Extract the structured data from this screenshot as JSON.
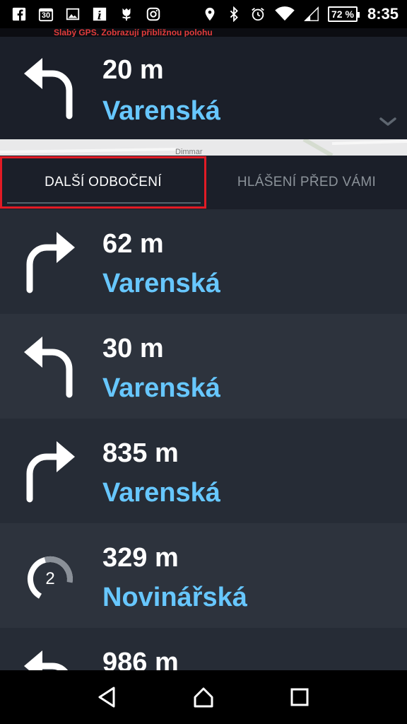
{
  "status_bar": {
    "left_icons": [
      "facebook-icon",
      "calendar-30-icon",
      "image-icon",
      "info-icon",
      "tulip-icon",
      "instagram-icon"
    ],
    "calendar_day": "30",
    "right_icons": [
      "location-icon",
      "bluetooth-icon",
      "alarm-icon",
      "wifi-icon",
      "signal-icon"
    ],
    "battery": "72 %",
    "time": "8:35"
  },
  "banner": {
    "text": "Slabý GPS. Zobrazují přibližnou polohu"
  },
  "current_instruction": {
    "direction": "left",
    "distance": "20 m",
    "street": "Varenská"
  },
  "map_peek": {
    "label": "Dimmar"
  },
  "tabs": {
    "turns": "DALŠÍ ODBOČENÍ",
    "reports": "HLÁŠENÍ PŘED VÁMI"
  },
  "turns": [
    {
      "direction": "right",
      "distance": "62 m",
      "street": "Varenská"
    },
    {
      "direction": "left",
      "distance": "30 m",
      "street": "Varenská"
    },
    {
      "direction": "right",
      "distance": "835 m",
      "street": "Varenská"
    },
    {
      "direction": "roundabout",
      "exit": "2",
      "distance": "329 m",
      "street": "Novinářská"
    },
    {
      "direction": "left",
      "distance": "986 m",
      "street": ""
    }
  ],
  "colors": {
    "street": "#67c7ff",
    "highlight": "#e21b25",
    "banner_text": "#e23c3c"
  }
}
